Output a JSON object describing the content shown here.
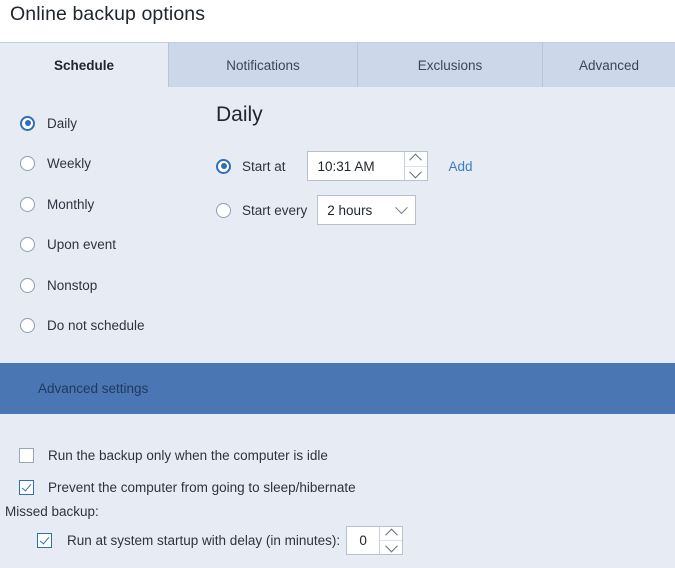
{
  "window": {
    "title": "Online backup options"
  },
  "tabs": [
    {
      "label": "Schedule",
      "active": true
    },
    {
      "label": "Notifications",
      "active": false
    },
    {
      "label": "Exclusions",
      "active": false
    },
    {
      "label": "Advanced",
      "active": false
    }
  ],
  "schedule": {
    "frequency_options": [
      {
        "label": "Daily",
        "selected": true
      },
      {
        "label": "Weekly",
        "selected": false
      },
      {
        "label": "Monthly",
        "selected": false
      },
      {
        "label": "Upon event",
        "selected": false
      },
      {
        "label": "Nonstop",
        "selected": false
      },
      {
        "label": "Do not schedule",
        "selected": false
      }
    ],
    "panel_title": "Daily",
    "start_at": {
      "label": "Start at",
      "selected": true,
      "value": "10:31 AM"
    },
    "add_link": "Add",
    "start_every": {
      "label": "Start every",
      "selected": false,
      "value": "2 hours"
    }
  },
  "advanced_settings": {
    "header": "Advanced settings",
    "header_color": "#4a77b4",
    "run_idle": {
      "label": "Run the backup only when the computer is idle",
      "checked": false
    },
    "prevent_sleep": {
      "label": "Prevent the computer from going to sleep/hibernate",
      "checked": true
    },
    "missed_backup_label": "Missed backup:",
    "run_at_startup": {
      "label": "Run at system startup with delay (in minutes):",
      "checked": true,
      "value": "0"
    }
  },
  "colors": {
    "accent": "#2f6fb5",
    "link": "#3c7cbf",
    "panel_bg": "#e7ecf4",
    "tab_inactive": "#ccd7ea"
  }
}
